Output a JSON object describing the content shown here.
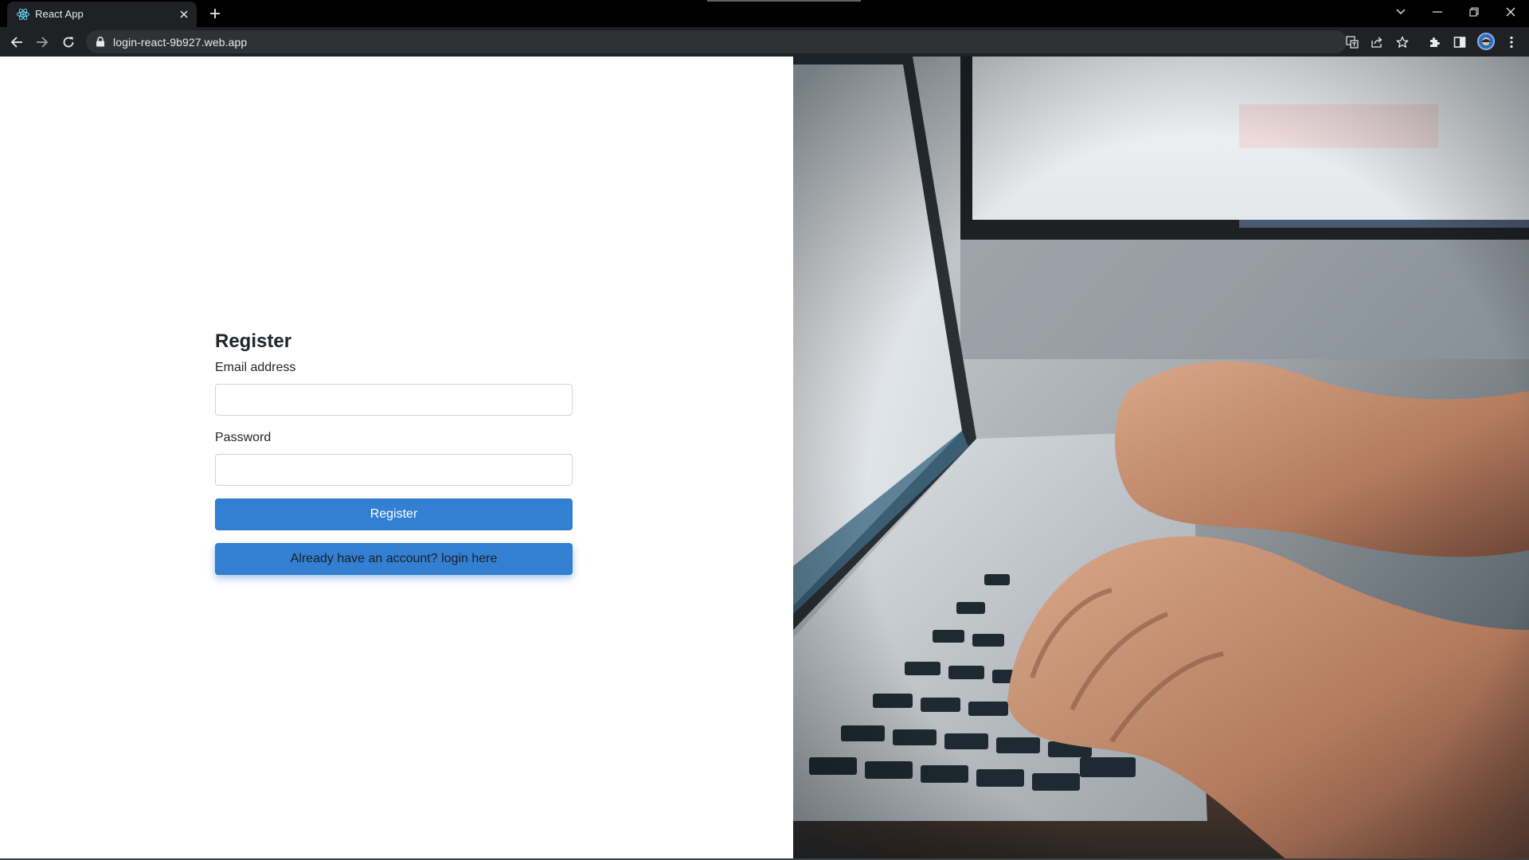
{
  "browser": {
    "tab_title": "React App",
    "url": "login-react-9b927.web.app"
  },
  "register_form": {
    "title": "Register",
    "email_label": "Email address",
    "email_value": "",
    "password_label": "Password",
    "password_value": "",
    "register_button": "Register",
    "login_link_button": "Already have an account? login here"
  },
  "hero_image": {
    "subject": "hands-typing-on-laptop"
  },
  "colors": {
    "primary_button": "#3380d3",
    "browser_dark": "#202124",
    "heading_text": "#212529"
  }
}
